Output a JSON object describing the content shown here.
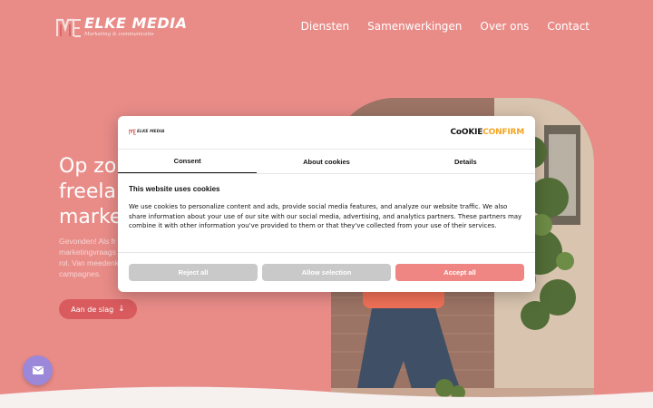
{
  "header": {
    "logo_title": "ELKE MEDIA",
    "logo_subtitle": "Marketing & communicatie",
    "nav": [
      "Diensten",
      "Samenwerkingen",
      "Over ons",
      "Contact"
    ]
  },
  "hero": {
    "title": "Op zo\nfreelar\nmarke",
    "text": "Gevonden! Als fr\nmarketingvraags\nrol. Van meedenk\ncampagnes.",
    "cta_label": "Aan de slag",
    "cta_icon": "arrow-down-icon"
  },
  "floating": {
    "icon": "mail-icon"
  },
  "cookie_dialog": {
    "logo_text": "ELKE MEDIA",
    "brand_part1": "C",
    "brand_part2": "OKIE",
    "brand_part3": "CONFIRM",
    "tabs": [
      "Consent",
      "About cookies",
      "Details"
    ],
    "active_tab": "Consent",
    "title": "This website uses cookies",
    "body": "We use cookies to personalize content and ads, provide social media features, and analyze our website traffic. We also share information about your use of our site with our social media, advertising, and analytics partners. These partners may combine it with other information you've provided to them or that they've collected from your use of their services.",
    "buttons": {
      "reject": "Reject all",
      "allow_selection": "Allow selection",
      "accept": "Accept all"
    }
  },
  "colors": {
    "background": "#e98a86",
    "cta": "#d9585b",
    "accept": "#f08683",
    "grey_button": "#c9c9c9",
    "brand_orange": "#f4a521",
    "chat_button": "#9a86d8"
  }
}
